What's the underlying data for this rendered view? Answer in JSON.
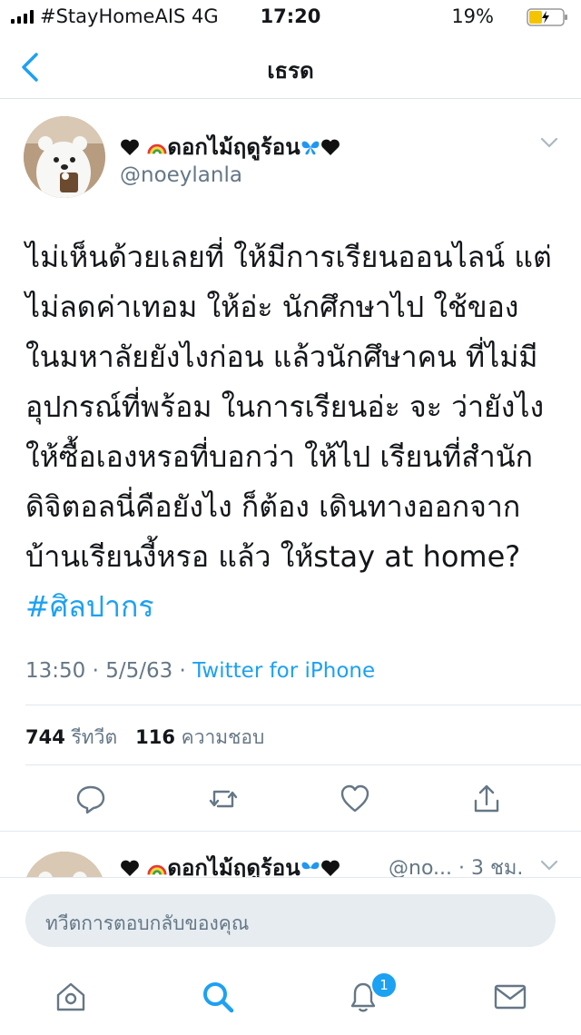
{
  "status_bar": {
    "carrier": "#StayHomeAIS  4G",
    "time": "17:20",
    "battery": "19%"
  },
  "nav": {
    "title": "เธรด",
    "back_icon": "chevron-left-icon"
  },
  "tweet": {
    "author_name": "ดอกไม้ฤดูร้อน",
    "author_handle": "@noeylanla",
    "body": "ไม่เห็นด้วยเลยที่ ให้มีการเรียนออนไลน์ แต่ไม่ลดค่าเทอม ให้อ่ะ นักศึกษาไป ใช้ของ ในมหาลัยยังไงก่อน แล้วนักศึษาคน ที่ไม่มีอุปกรณ์ที่พร้อม ในการเรียนอ่ะ จะ ว่ายังไง  ให้ซื้อเองหรอที่บอกว่า ให้ไป เรียนที่สำนักดิจิตอลนี่คือยังไง ก็ต้อง เดินทางออกจากบ้านเรียนงี้หรอ แล้ว ให้stay at home?",
    "hashtag": "#ศิลปากร",
    "timestamp": "13:50 · 5/5/63 · ",
    "source": "Twitter for iPhone",
    "retweet_count": "744",
    "retweet_label": "รีทวีต",
    "like_count": "116",
    "like_label": "ความชอบ"
  },
  "reply": {
    "author_name": "ดอกไม้ฤดูร้อน",
    "author_handle": "@no... · 3 ชม."
  },
  "compose": {
    "placeholder": "ทวีตการตอบกลับของคุณ"
  },
  "tabbar": {
    "notification_badge": "1"
  },
  "colors": {
    "accent": "#1da1f2",
    "secondary_text": "#657786"
  }
}
